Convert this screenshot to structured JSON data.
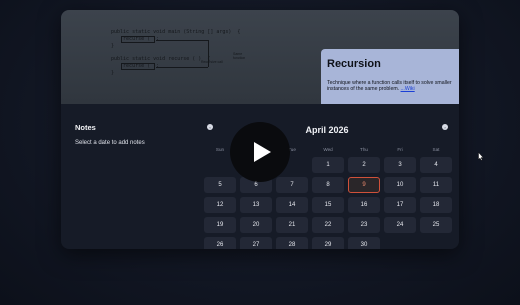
{
  "hero": {
    "code_lines": [
      "public static void main (String [] args)  {",
      "    recurse ( );",
      "}",
      "",
      "public static void recurse ( )  {",
      "    recurse ( );",
      "}"
    ],
    "code_notes": [
      "Recursive call",
      "Same function"
    ]
  },
  "info_card": {
    "title": "Recursion",
    "description": "Technique where a function calls itself to solve smaller instances of the same problem.",
    "link_label": "...Wiki"
  },
  "notes": {
    "title": "Notes",
    "empty_text": "Select a date to add notes"
  },
  "calendar": {
    "month_label": "April 2026",
    "weekdays": [
      "Sun",
      "Mon",
      "Tue",
      "Wed",
      "Thu",
      "Fri",
      "Sat"
    ],
    "days": [
      "1",
      "2",
      "3",
      "4",
      "5",
      "6",
      "7",
      "8",
      "9",
      "10",
      "11",
      "12",
      "13",
      "14",
      "15",
      "16",
      "17",
      "18",
      "19",
      "20",
      "21",
      "22",
      "23",
      "24",
      "25",
      "26",
      "27",
      "28",
      "29",
      "30"
    ],
    "first_weekday_index": 3,
    "today": "9",
    "prev_icon": "chevron-left-icon",
    "next_icon": "chevron-right-icon",
    "today_color": "#d0513a"
  },
  "video_overlay": {
    "icon": "play-icon"
  }
}
